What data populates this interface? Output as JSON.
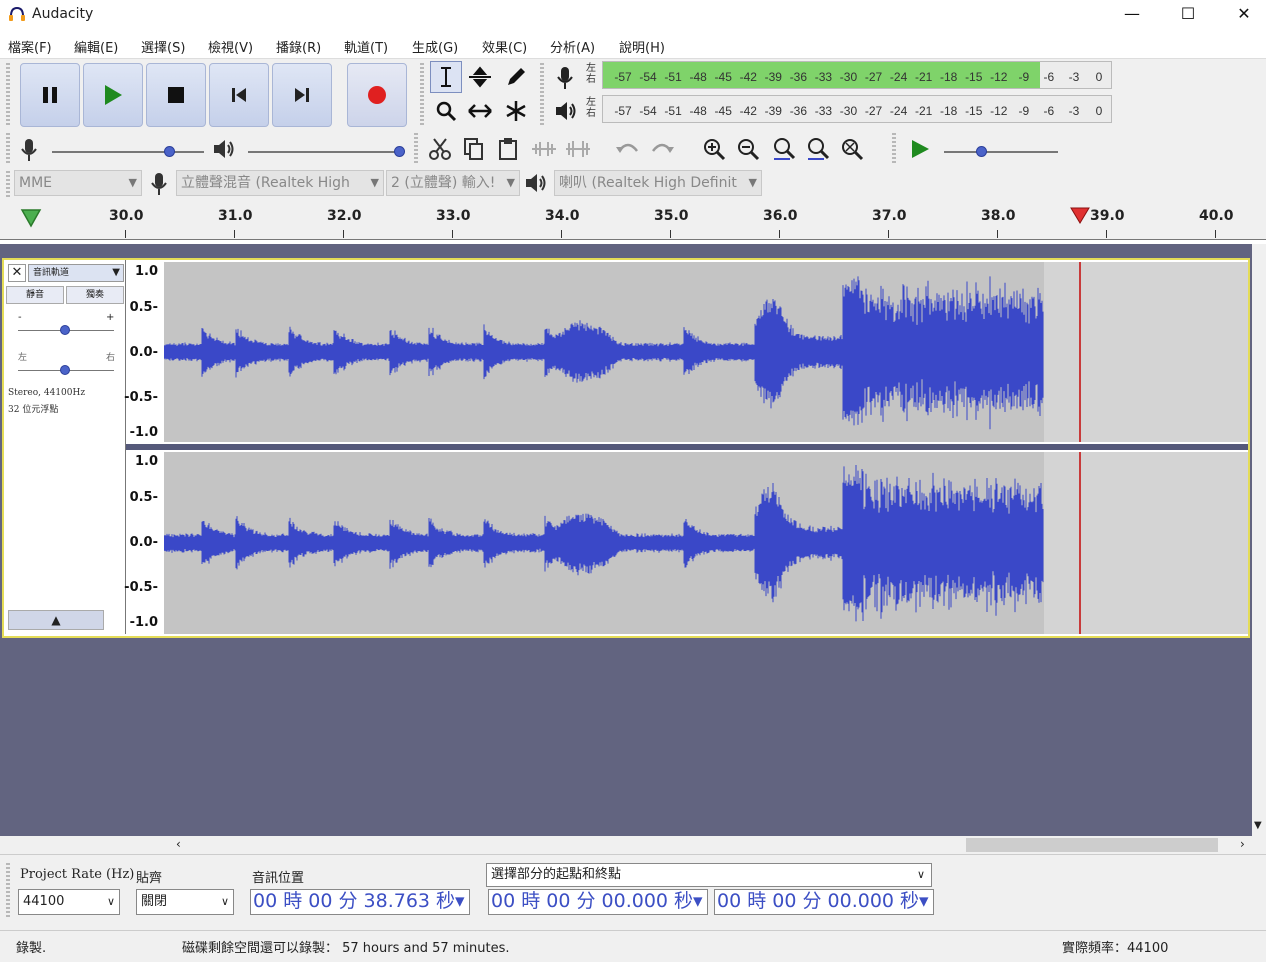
{
  "window": {
    "title": "Audacity",
    "minimize": "—",
    "maximize": "☐",
    "close": "✕"
  },
  "menu": [
    "檔案(F)",
    "編輯(E)",
    "選擇(S)",
    "檢視(V)",
    "播錄(R)",
    "軌道(T)",
    "生成(G)",
    "效果(C)",
    "分析(A)",
    "說明(H)"
  ],
  "meters": {
    "record_lr": "左\n右",
    "play_lr": "左\n右",
    "scale": [
      "-57",
      "-54",
      "-51",
      "-48",
      "-45",
      "-42",
      "-39",
      "-36",
      "-33",
      "-30",
      "-27",
      "-24",
      "-21",
      "-18",
      "-15",
      "-12",
      "-9",
      "-6",
      "-3",
      "0"
    ],
    "record_level": 0.86
  },
  "devices": {
    "host": "MME",
    "input": "立體聲混音 (Realtek High",
    "channels": "2 (立體聲) 輸入!",
    "output": "喇叭 (Realtek High Definit"
  },
  "timeline": {
    "labels": [
      "30.0",
      "31.0",
      "32.0",
      "33.0",
      "34.0",
      "35.0",
      "36.0",
      "37.0",
      "38.0",
      "39.0",
      "40.0"
    ]
  },
  "track": {
    "name": "音訊軌道",
    "mute": "靜音",
    "solo": "獨奏",
    "gain_minus": "-",
    "gain_plus": "+",
    "pan_left": "左",
    "pan_right": "右",
    "format": "Stereo, 44100Hz",
    "bits": "32 位元浮點",
    "y_labels": [
      "1.0",
      "0.5-",
      "0.0-",
      "-0.5-",
      "-1.0"
    ]
  },
  "selection": {
    "rate_label": "Project Rate (Hz)",
    "rate_value": "44100",
    "snap_label": "貼齊",
    "snap_value": "關閉",
    "pos_label": "音訊位置",
    "pos_value": "00 時 00 分 38.763 秒▾",
    "range_label": "選擇部分的起點和終點",
    "start_value": "00 時 00 分 00.000 秒▾",
    "end_value": "00 時 00 分 00.000 秒▾"
  },
  "status": {
    "left": "錄製.",
    "middle": "磁碟剩餘空間還可以錄製： 57 hours and 57 minutes.",
    "right": "實際頻率：44100"
  },
  "colors": {
    "wave": "#3a48c8",
    "wave_bg": "#c4c4c4",
    "track_border": "#e4dc57",
    "tracks_bg": "#626480"
  }
}
